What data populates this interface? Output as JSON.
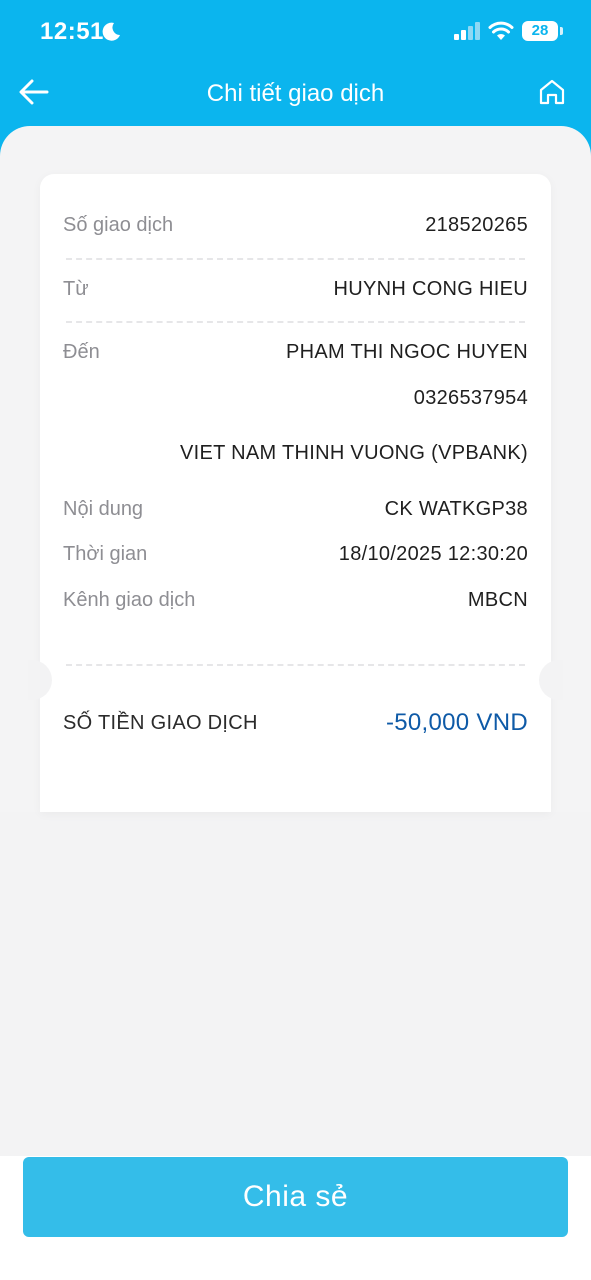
{
  "status_bar": {
    "time": "12:51",
    "battery": "28"
  },
  "header": {
    "title": "Chi tiết giao dịch"
  },
  "transaction": {
    "id_label": "Số giao dịch",
    "id_value": "218520265",
    "from_label": "Từ",
    "from_value": "HUYNH CONG HIEU",
    "to_label": "Đến",
    "to_name": "PHAM THI NGOC HUYEN",
    "to_account": "0326537954",
    "to_bank": "VIET NAM THINH VUONG (VPBANK)",
    "content_label": "Nội dung",
    "content_value": "CK WATKGP38",
    "time_label": "Thời gian",
    "time_value": "18/10/2025 12:30:20",
    "channel_label": "Kênh giao dịch",
    "channel_value": "MBCN",
    "amount_label": "SỐ TIỀN GIAO DỊCH",
    "amount_value": "-50,000 VND"
  },
  "actions": {
    "share_label": "Chia sẻ"
  },
  "colors": {
    "header_bg": "#0bb5ee",
    "button_bg": "#34bde9",
    "amount": "#0e5aa7"
  },
  "icons": [
    "moon-icon",
    "cellular-signal-icon",
    "wifi-icon",
    "battery-icon",
    "back-arrow-icon",
    "home-icon"
  ]
}
